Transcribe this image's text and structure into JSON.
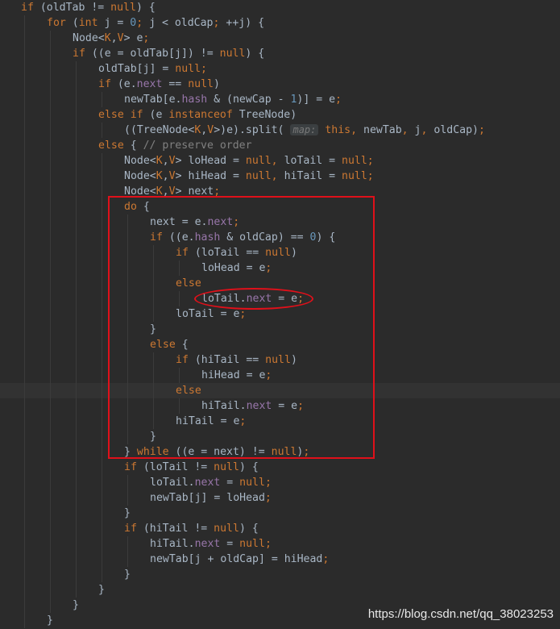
{
  "editor": {
    "lines": [
      "if (oldTab != null) {",
      "for (int j = 0; j < oldCap; ++j) {",
      "Node<K,V> e;",
      "if ((e = oldTab[j]) != null) {",
      "oldTab[j] = null;",
      "if (e.next == null)",
      "newTab[e.hash & (newCap - 1)] = e;",
      "else if (e instanceof TreeNode)",
      "((TreeNode<K,V>)e).split( map: this, newTab, j, oldCap);",
      "else { // preserve order",
      "Node<K,V> loHead = null, loTail = null;",
      "Node<K,V> hiHead = null, hiTail = null;",
      "Node<K,V> next;",
      "do {",
      "next = e.next;",
      "if ((e.hash & oldCap) == 0) {",
      "if (loTail == null)",
      "loHead = e;",
      "else",
      "loTail.next = e;",
      "loTail = e;",
      "}",
      "else {",
      "if (hiTail == null)",
      "hiHead = e;",
      "else",
      "hiTail.next = e;",
      "hiTail = e;",
      "}",
      "} while ((e = next) != null);",
      "if (loTail != null) {",
      "loTail.next = null;",
      "newTab[j] = loHead;",
      "}",
      "if (hiTail != null) {",
      "hiTail.next = null;",
      "newTab[j + oldCap] = hiHead;",
      "}",
      "}",
      "}",
      "}"
    ],
    "inlay_hint": "map:",
    "current_line": 25
  },
  "annotations": {
    "box_color": "#e0101a"
  },
  "watermark": "https://blog.csdn.net/qq_38023253"
}
